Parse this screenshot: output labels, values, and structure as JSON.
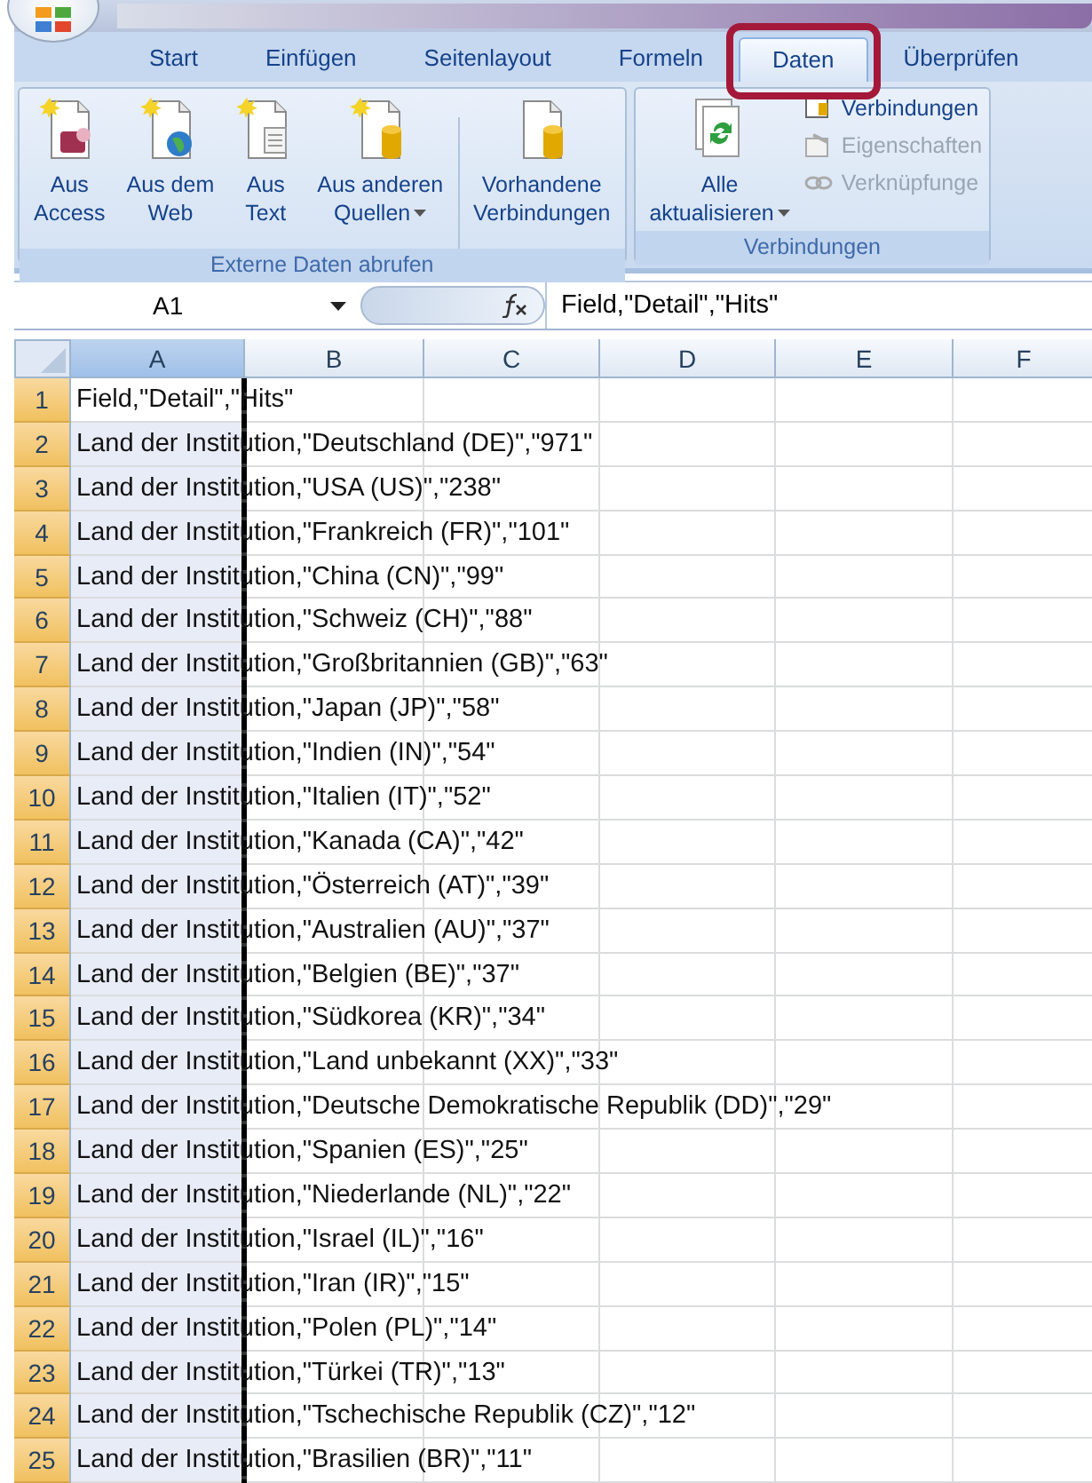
{
  "tabs": [
    {
      "label": "Start",
      "selected": false
    },
    {
      "label": "Einfügen",
      "selected": false
    },
    {
      "label": "Seitenlayout",
      "selected": false
    },
    {
      "label": "Formeln",
      "selected": false
    },
    {
      "label": "Daten",
      "selected": true
    },
    {
      "label": "Überprüfen",
      "selected": false
    }
  ],
  "ribbon": {
    "groups": [
      {
        "title": "Externe Daten abrufen",
        "buttons": [
          {
            "kind": "access",
            "lines": [
              "Aus",
              "Access"
            ],
            "dropdown": false
          },
          {
            "kind": "web",
            "lines": [
              "Aus dem",
              "Web"
            ],
            "dropdown": false
          },
          {
            "kind": "text",
            "lines": [
              "Aus",
              "Text"
            ],
            "dropdown": false
          },
          {
            "kind": "database",
            "lines": [
              "Aus anderen",
              "Quellen"
            ],
            "dropdown": true
          },
          {
            "kind": "existing",
            "lines": [
              "Vorhandene",
              "Verbindungen"
            ],
            "dropdown": false
          }
        ]
      },
      {
        "title": "Verbindungen",
        "buttons": [
          {
            "kind": "refresh",
            "lines": [
              "Alle",
              "aktualisieren"
            ],
            "dropdown": true
          }
        ],
        "items": [
          {
            "kind": "connections",
            "label": "Verbindungen",
            "disabled": false
          },
          {
            "kind": "properties",
            "label": "Eigenschaften",
            "disabled": true
          },
          {
            "kind": "links",
            "label": "Verknüpfunge",
            "disabled": true
          }
        ]
      }
    ]
  },
  "name_box": "A1",
  "formula": "Field,\"Detail\",\"Hits\"",
  "columns": [
    {
      "label": "A",
      "selected": true
    },
    {
      "label": "B",
      "selected": false
    },
    {
      "label": "C",
      "selected": false
    },
    {
      "label": "D",
      "selected": false
    },
    {
      "label": "E",
      "selected": false
    },
    {
      "label": "F",
      "selected": false
    }
  ],
  "rows": [
    {
      "number": "1",
      "text": "Field,\"Detail\",\"Hits\""
    },
    {
      "number": "2",
      "text": "Land der Institution,\"Deutschland (DE)\",\"971\""
    },
    {
      "number": "3",
      "text": "Land der Institution,\"USA (US)\",\"238\""
    },
    {
      "number": "4",
      "text": "Land der Institution,\"Frankreich (FR)\",\"101\""
    },
    {
      "number": "5",
      "text": "Land der Institution,\"China (CN)\",\"99\""
    },
    {
      "number": "6",
      "text": "Land der Institution,\"Schweiz (CH)\",\"88\""
    },
    {
      "number": "7",
      "text": "Land der Institution,\"Großbritannien (GB)\",\"63\""
    },
    {
      "number": "8",
      "text": "Land der Institution,\"Japan (JP)\",\"58\""
    },
    {
      "number": "9",
      "text": "Land der Institution,\"Indien (IN)\",\"54\""
    },
    {
      "number": "10",
      "text": "Land der Institution,\"Italien (IT)\",\"52\""
    },
    {
      "number": "11",
      "text": "Land der Institution,\"Kanada (CA)\",\"42\""
    },
    {
      "number": "12",
      "text": "Land der Institution,\"Österreich (AT)\",\"39\""
    },
    {
      "number": "13",
      "text": "Land der Institution,\"Australien (AU)\",\"37\""
    },
    {
      "number": "14",
      "text": "Land der Institution,\"Belgien (BE)\",\"37\""
    },
    {
      "number": "15",
      "text": "Land der Institution,\"Südkorea (KR)\",\"34\""
    },
    {
      "number": "16",
      "text": "Land der Institution,\"Land unbekannt (XX)\",\"33\""
    },
    {
      "number": "17",
      "text": "Land der Institution,\"Deutsche Demokratische Republik (DD)\",\"29\""
    },
    {
      "number": "18",
      "text": "Land der Institution,\"Spanien (ES)\",\"25\""
    },
    {
      "number": "19",
      "text": "Land der Institution,\"Niederlande (NL)\",\"22\""
    },
    {
      "number": "20",
      "text": "Land der Institution,\"Israel (IL)\",\"16\""
    },
    {
      "number": "21",
      "text": "Land der Institution,\"Iran (IR)\",\"15\""
    },
    {
      "number": "22",
      "text": "Land der Institution,\"Polen (PL)\",\"14\""
    },
    {
      "number": "23",
      "text": "Land der Institution,\"Türkei (TR)\",\"13\""
    },
    {
      "number": "24",
      "text": "Land der Institution,\"Tschechische Republik (CZ)\",\"12\""
    },
    {
      "number": "25",
      "text": "Land der Institution,\"Brasilien (BR)\",\"11\""
    }
  ]
}
